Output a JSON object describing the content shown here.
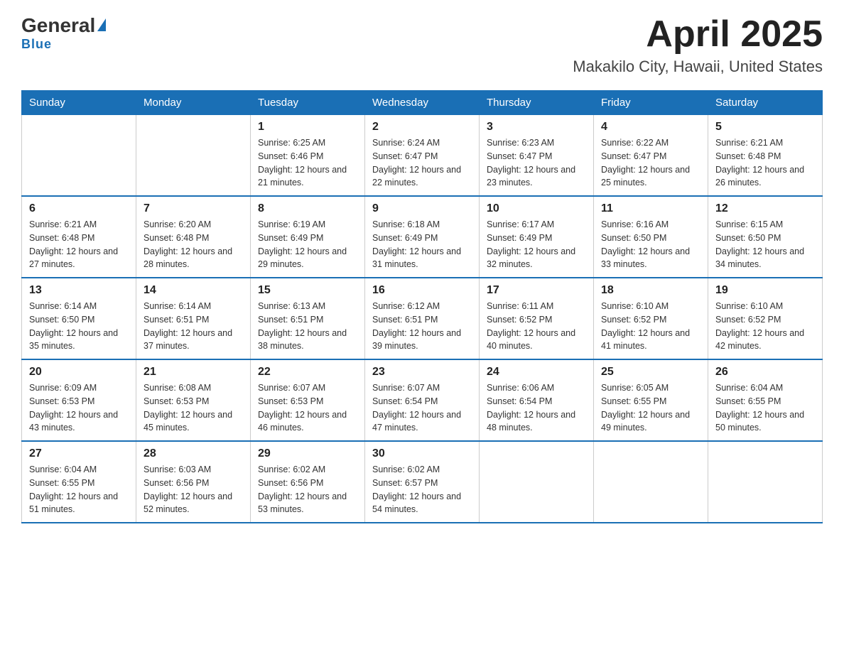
{
  "logo": {
    "general": "General",
    "blue": "Blue"
  },
  "header": {
    "month": "April 2025",
    "location": "Makakilo City, Hawaii, United States"
  },
  "days_of_week": [
    "Sunday",
    "Monday",
    "Tuesday",
    "Wednesday",
    "Thursday",
    "Friday",
    "Saturday"
  ],
  "weeks": [
    [
      {
        "day": "",
        "info": ""
      },
      {
        "day": "",
        "info": ""
      },
      {
        "day": "1",
        "info": "Sunrise: 6:25 AM\nSunset: 6:46 PM\nDaylight: 12 hours and 21 minutes."
      },
      {
        "day": "2",
        "info": "Sunrise: 6:24 AM\nSunset: 6:47 PM\nDaylight: 12 hours and 22 minutes."
      },
      {
        "day": "3",
        "info": "Sunrise: 6:23 AM\nSunset: 6:47 PM\nDaylight: 12 hours and 23 minutes."
      },
      {
        "day": "4",
        "info": "Sunrise: 6:22 AM\nSunset: 6:47 PM\nDaylight: 12 hours and 25 minutes."
      },
      {
        "day": "5",
        "info": "Sunrise: 6:21 AM\nSunset: 6:48 PM\nDaylight: 12 hours and 26 minutes."
      }
    ],
    [
      {
        "day": "6",
        "info": "Sunrise: 6:21 AM\nSunset: 6:48 PM\nDaylight: 12 hours and 27 minutes."
      },
      {
        "day": "7",
        "info": "Sunrise: 6:20 AM\nSunset: 6:48 PM\nDaylight: 12 hours and 28 minutes."
      },
      {
        "day": "8",
        "info": "Sunrise: 6:19 AM\nSunset: 6:49 PM\nDaylight: 12 hours and 29 minutes."
      },
      {
        "day": "9",
        "info": "Sunrise: 6:18 AM\nSunset: 6:49 PM\nDaylight: 12 hours and 31 minutes."
      },
      {
        "day": "10",
        "info": "Sunrise: 6:17 AM\nSunset: 6:49 PM\nDaylight: 12 hours and 32 minutes."
      },
      {
        "day": "11",
        "info": "Sunrise: 6:16 AM\nSunset: 6:50 PM\nDaylight: 12 hours and 33 minutes."
      },
      {
        "day": "12",
        "info": "Sunrise: 6:15 AM\nSunset: 6:50 PM\nDaylight: 12 hours and 34 minutes."
      }
    ],
    [
      {
        "day": "13",
        "info": "Sunrise: 6:14 AM\nSunset: 6:50 PM\nDaylight: 12 hours and 35 minutes."
      },
      {
        "day": "14",
        "info": "Sunrise: 6:14 AM\nSunset: 6:51 PM\nDaylight: 12 hours and 37 minutes."
      },
      {
        "day": "15",
        "info": "Sunrise: 6:13 AM\nSunset: 6:51 PM\nDaylight: 12 hours and 38 minutes."
      },
      {
        "day": "16",
        "info": "Sunrise: 6:12 AM\nSunset: 6:51 PM\nDaylight: 12 hours and 39 minutes."
      },
      {
        "day": "17",
        "info": "Sunrise: 6:11 AM\nSunset: 6:52 PM\nDaylight: 12 hours and 40 minutes."
      },
      {
        "day": "18",
        "info": "Sunrise: 6:10 AM\nSunset: 6:52 PM\nDaylight: 12 hours and 41 minutes."
      },
      {
        "day": "19",
        "info": "Sunrise: 6:10 AM\nSunset: 6:52 PM\nDaylight: 12 hours and 42 minutes."
      }
    ],
    [
      {
        "day": "20",
        "info": "Sunrise: 6:09 AM\nSunset: 6:53 PM\nDaylight: 12 hours and 43 minutes."
      },
      {
        "day": "21",
        "info": "Sunrise: 6:08 AM\nSunset: 6:53 PM\nDaylight: 12 hours and 45 minutes."
      },
      {
        "day": "22",
        "info": "Sunrise: 6:07 AM\nSunset: 6:53 PM\nDaylight: 12 hours and 46 minutes."
      },
      {
        "day": "23",
        "info": "Sunrise: 6:07 AM\nSunset: 6:54 PM\nDaylight: 12 hours and 47 minutes."
      },
      {
        "day": "24",
        "info": "Sunrise: 6:06 AM\nSunset: 6:54 PM\nDaylight: 12 hours and 48 minutes."
      },
      {
        "day": "25",
        "info": "Sunrise: 6:05 AM\nSunset: 6:55 PM\nDaylight: 12 hours and 49 minutes."
      },
      {
        "day": "26",
        "info": "Sunrise: 6:04 AM\nSunset: 6:55 PM\nDaylight: 12 hours and 50 minutes."
      }
    ],
    [
      {
        "day": "27",
        "info": "Sunrise: 6:04 AM\nSunset: 6:55 PM\nDaylight: 12 hours and 51 minutes."
      },
      {
        "day": "28",
        "info": "Sunrise: 6:03 AM\nSunset: 6:56 PM\nDaylight: 12 hours and 52 minutes."
      },
      {
        "day": "29",
        "info": "Sunrise: 6:02 AM\nSunset: 6:56 PM\nDaylight: 12 hours and 53 minutes."
      },
      {
        "day": "30",
        "info": "Sunrise: 6:02 AM\nSunset: 6:57 PM\nDaylight: 12 hours and 54 minutes."
      },
      {
        "day": "",
        "info": ""
      },
      {
        "day": "",
        "info": ""
      },
      {
        "day": "",
        "info": ""
      }
    ]
  ]
}
